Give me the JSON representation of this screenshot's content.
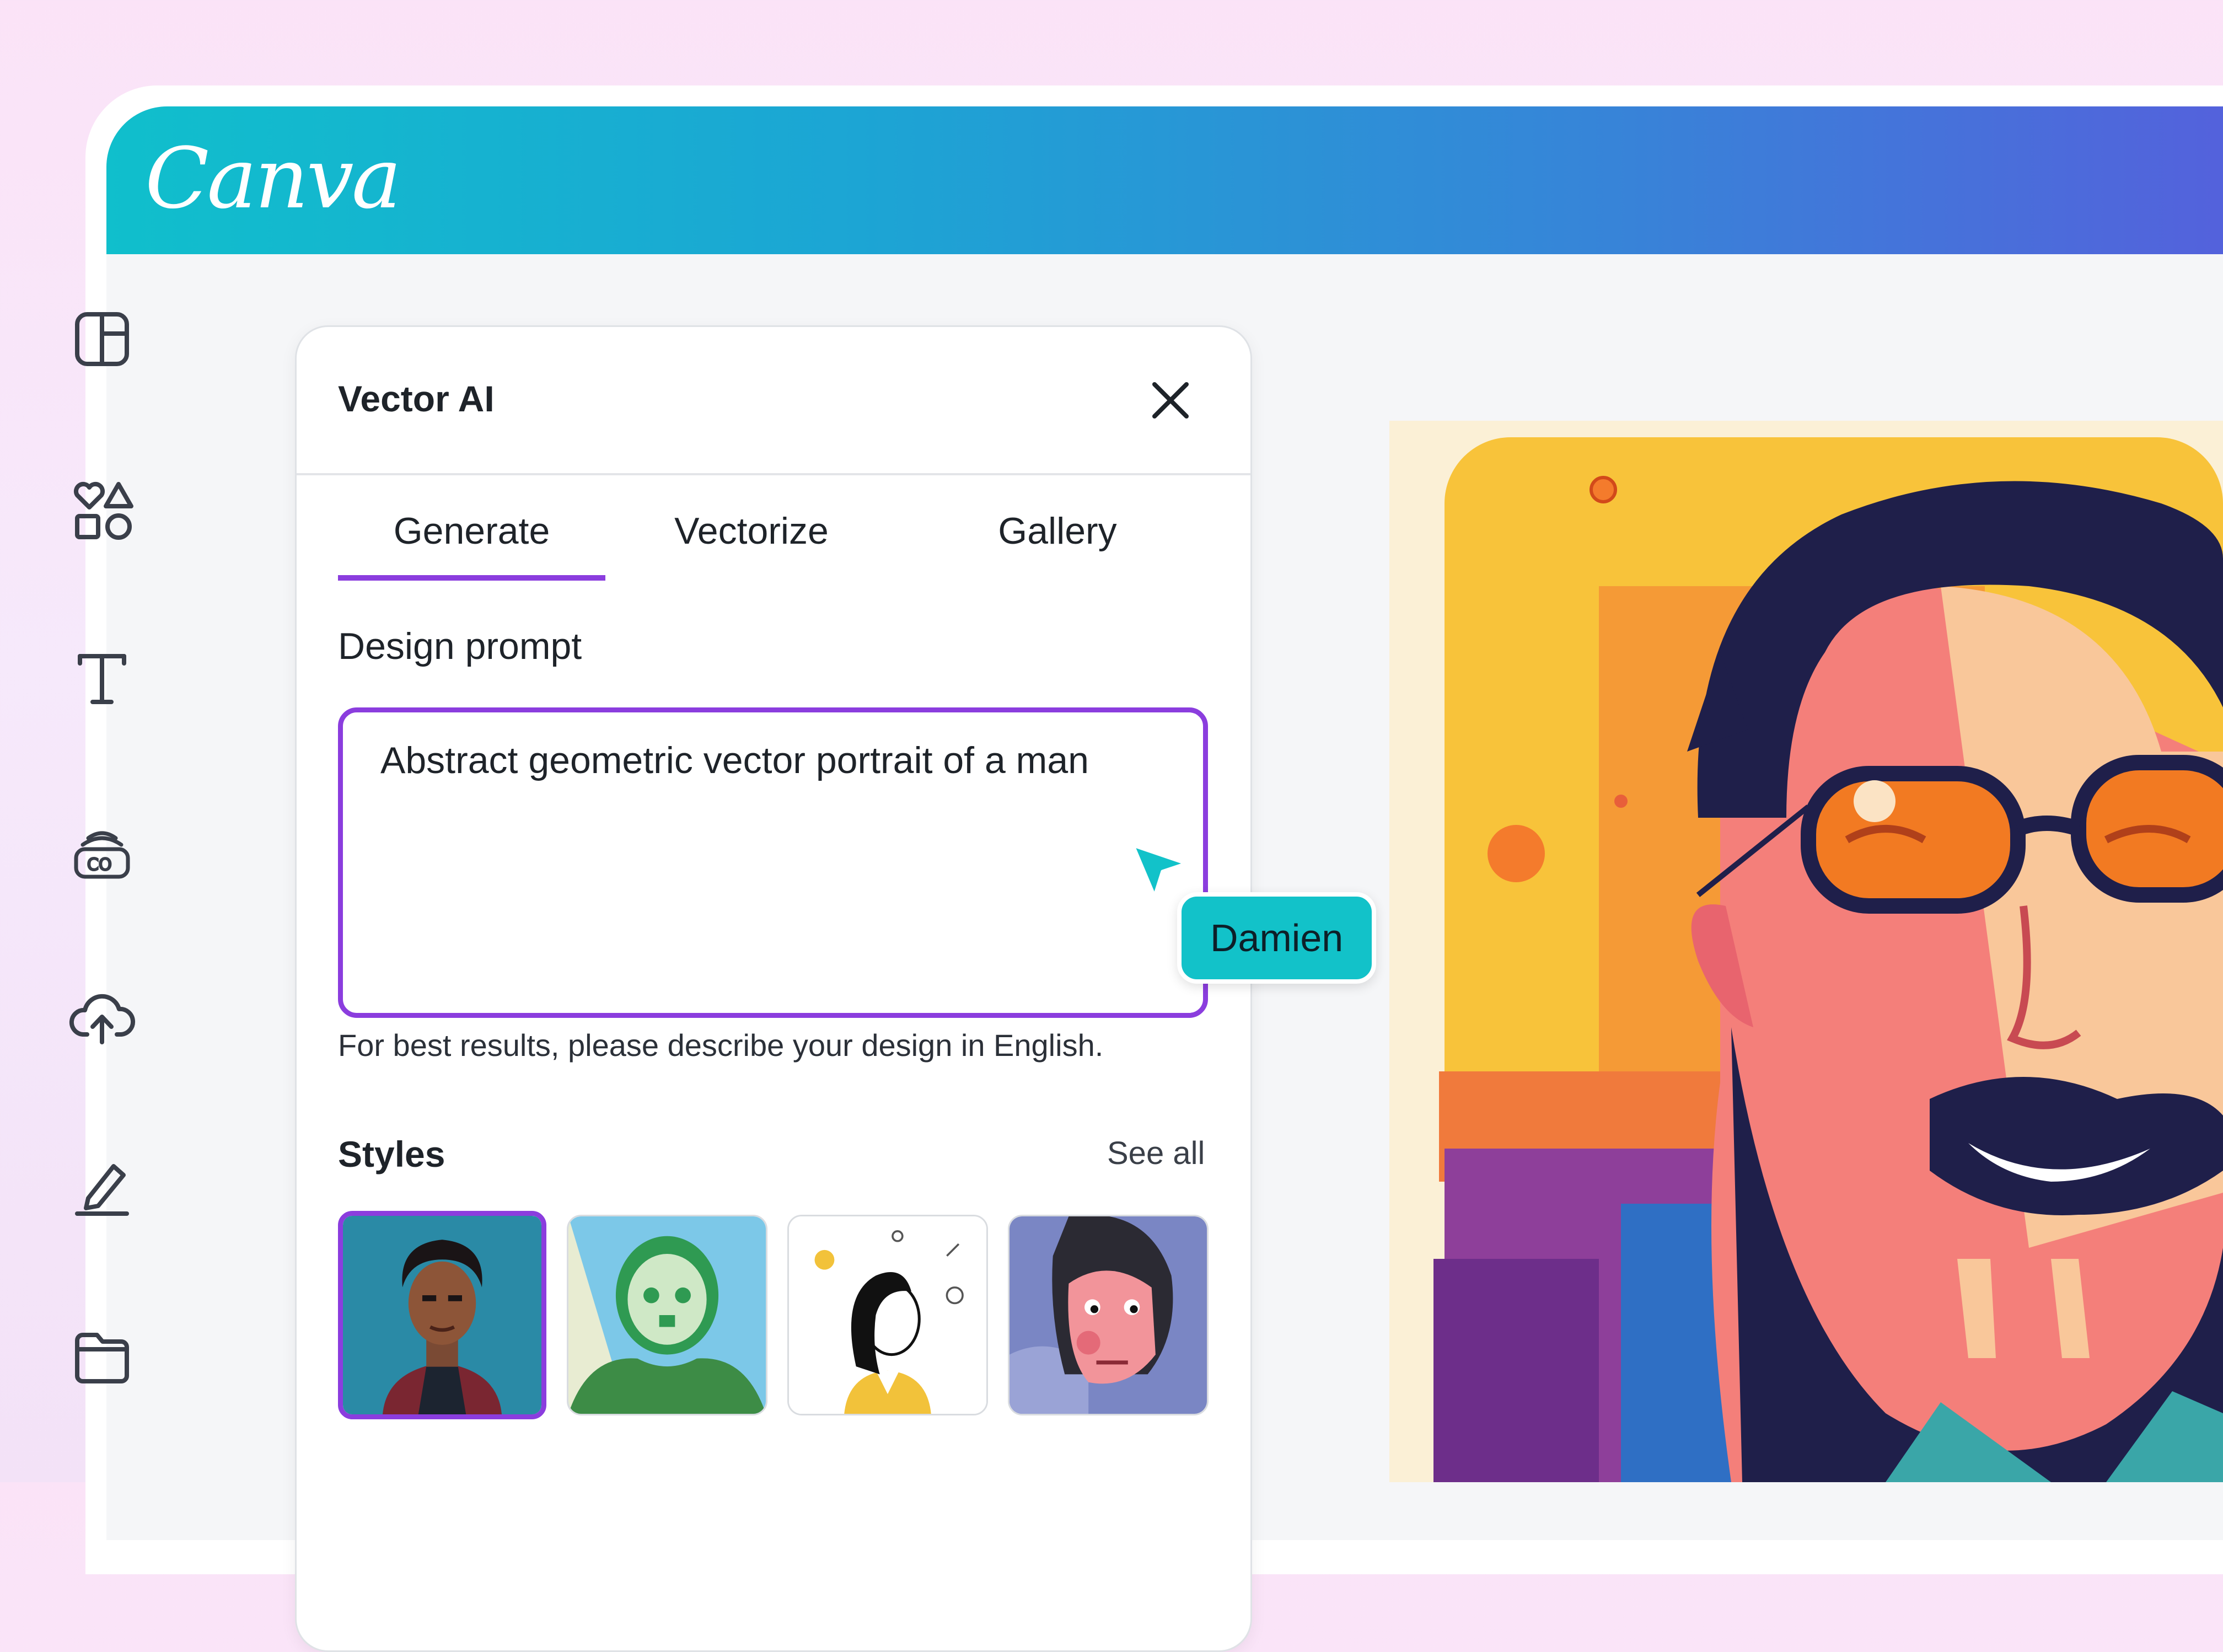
{
  "app": {
    "logo_text": "Canva"
  },
  "colors": {
    "accent": "#8b3dde",
    "header_start": "#10bfcc",
    "header_end": "#5560dc",
    "cursor": "#12c2c9"
  },
  "sidebar": {
    "items": [
      {
        "icon": "layout-icon"
      },
      {
        "icon": "elements-icon"
      },
      {
        "icon": "text-icon"
      },
      {
        "icon": "brand-icon"
      },
      {
        "icon": "upload-icon"
      },
      {
        "icon": "draw-icon"
      },
      {
        "icon": "folder-icon"
      }
    ]
  },
  "panel": {
    "title": "Vector AI",
    "tabs": [
      {
        "label": "Generate",
        "active": true
      },
      {
        "label": "Vectorize",
        "active": false
      },
      {
        "label": "Gallery",
        "active": false
      }
    ],
    "prompt_label": "Design prompt",
    "prompt_value": "Abstract geometric vector portrait of a man",
    "hint": "For best results, please describe your design in English.",
    "styles_title": "Styles",
    "see_all": "See all"
  },
  "collaborator": {
    "name": "Damien"
  }
}
